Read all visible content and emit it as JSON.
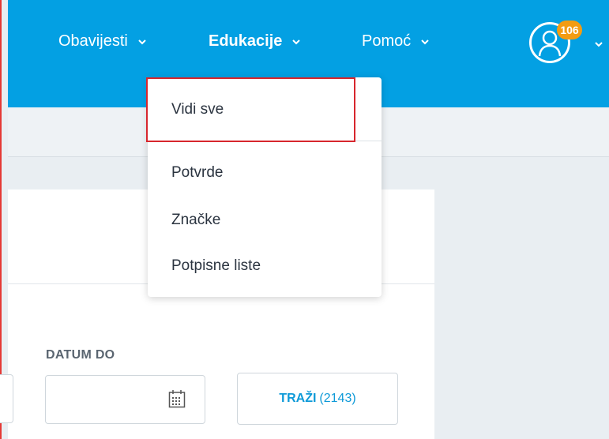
{
  "nav": {
    "items": [
      {
        "label": "Obavijesti"
      },
      {
        "label": "Edukacije"
      },
      {
        "label": "Pomoć"
      }
    ],
    "notification_count": "106"
  },
  "dropdown": {
    "items": [
      {
        "label": "Vidi sve"
      },
      {
        "label": "Potvrde"
      },
      {
        "label": "Značke"
      },
      {
        "label": "Potpisne liste"
      }
    ]
  },
  "filters": {
    "date_to_label": "DATUM DO",
    "date_to_value": ""
  },
  "search": {
    "label": "TRAŽI",
    "count": "(2143)"
  },
  "colors": {
    "header": "#03a0e3",
    "badge": "#f39c12",
    "highlight": "#d7262d",
    "accent": "#0e9ad8"
  },
  "icons": {
    "nav_dropdown": "chevron-down-icon",
    "user": "user-icon",
    "calendar": "calendar-icon"
  }
}
